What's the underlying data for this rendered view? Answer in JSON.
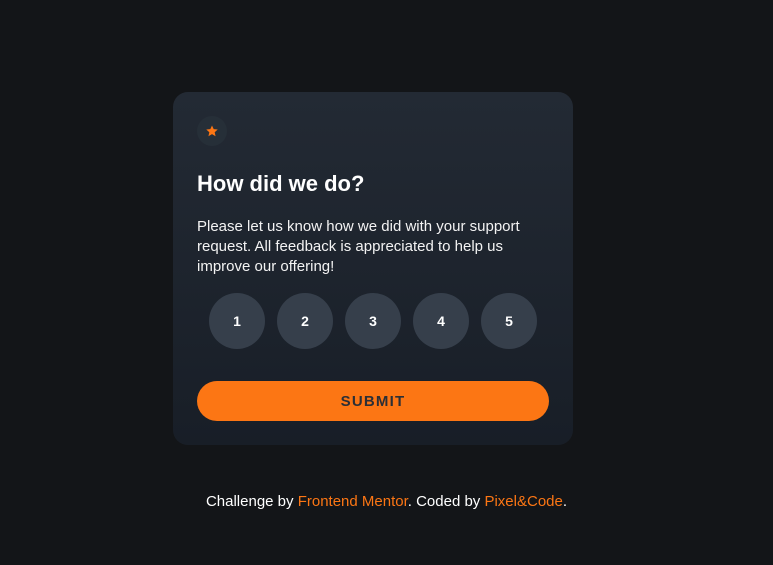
{
  "card": {
    "icon": "star-icon",
    "title": "How did we do?",
    "description": "Please let us know how we did with your support request. All feedback is appreciated to help us improve our offering!",
    "ratings": [
      "1",
      "2",
      "3",
      "4",
      "5"
    ],
    "submit_label": "SUBMIT"
  },
  "attribution": {
    "prefix": "Challenge by ",
    "link1": "Frontend Mentor",
    "middle": ". Coded by ",
    "link2": "Pixel&Code",
    "suffix": "."
  },
  "colors": {
    "background": "#131518",
    "card": "#232a34",
    "accent": "#fc7614",
    "rating_bg": "#363f4b",
    "text": "#ffffff"
  }
}
